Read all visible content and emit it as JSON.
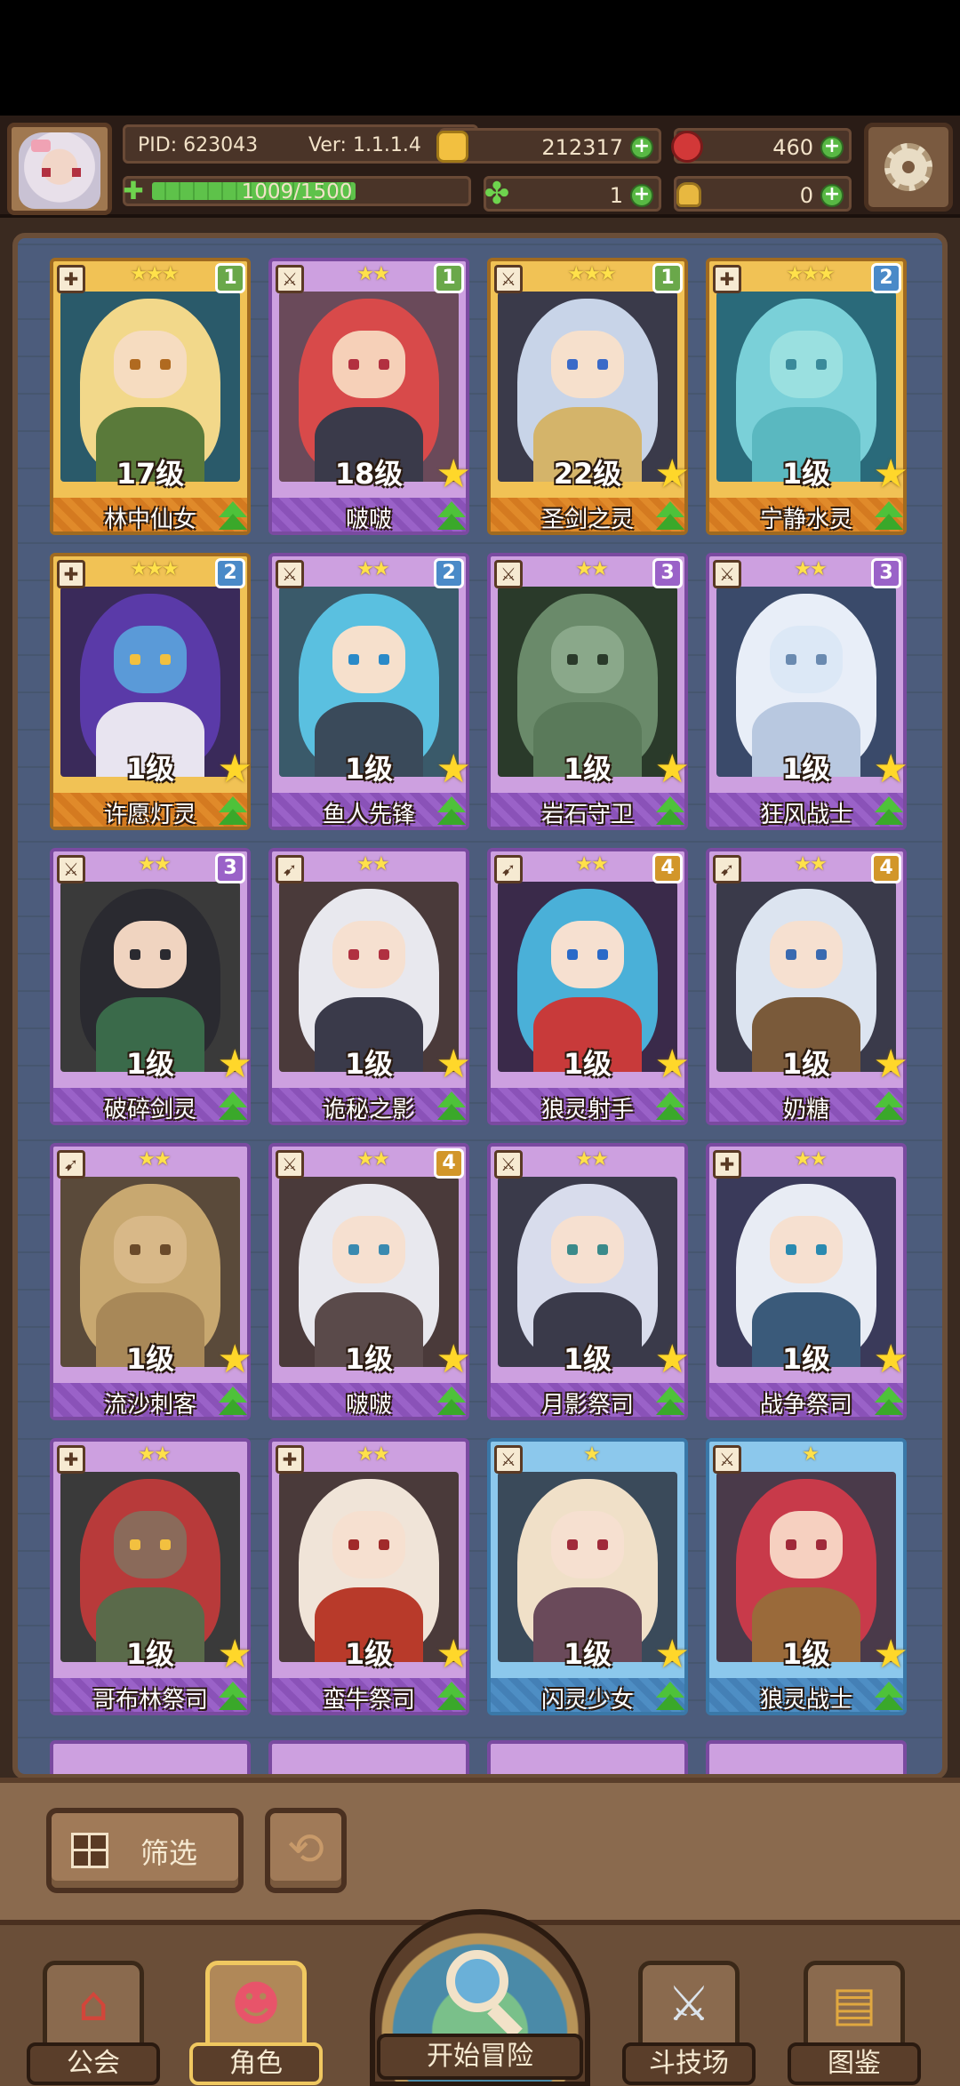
{
  "header": {
    "pid": "PID: 623043",
    "version": "Ver: 1.1.1.4",
    "xp_text": "1009/1500",
    "xp_fraction": 0.673,
    "gold": "212317",
    "apples": "460",
    "clovers": "1",
    "keys": "0"
  },
  "cards": [
    {
      "name": "林中仙女",
      "level": "17级",
      "stars": "★★★",
      "rank": "1",
      "rank_class": "r1",
      "frame": "gold",
      "class_icon": "✚",
      "hair": "#f2d88a",
      "skin": "#f6dcc0",
      "body": "#5a7a3a",
      "eye": "#b06a20",
      "bg": "#2a5a6a",
      "up": false
    },
    {
      "name": "啵啵",
      "level": "18级",
      "stars": "★★",
      "rank": "1",
      "rank_class": "r1",
      "frame": "purple",
      "class_icon": "⚔",
      "hair": "#d84a4a",
      "skin": "#f6d0b8",
      "body": "#3a3a4a",
      "eye": "#b23040",
      "bg": "#6a4a5a",
      "up": true
    },
    {
      "name": "圣剑之灵",
      "level": "22级",
      "stars": "★★★",
      "rank": "1",
      "rank_class": "r1",
      "frame": "gold",
      "class_icon": "⚔",
      "hair": "#c8d4e8",
      "skin": "#f6e0cc",
      "body": "#d4b46a",
      "eye": "#3a6ac8",
      "bg": "#3a3a4a",
      "up": true
    },
    {
      "name": "宁静水灵",
      "level": "1级",
      "stars": "★★★",
      "rank": "2",
      "rank_class": "r2",
      "frame": "gold",
      "class_icon": "✚",
      "hair": "#7ad0d8",
      "skin": "#9ae0e0",
      "body": "#5ab8c0",
      "eye": "#3a8a9a",
      "bg": "#2a6a7a",
      "up": true
    },
    {
      "name": "许愿灯灵",
      "level": "1级",
      "stars": "★★★",
      "rank": "2",
      "rank_class": "r2",
      "frame": "gold",
      "class_icon": "✚",
      "hair": "#5a3aa8",
      "skin": "#5a9ad8",
      "body": "#e8e4f0",
      "eye": "#f2c040",
      "bg": "#3a2a5a",
      "up": true
    },
    {
      "name": "鱼人先锋",
      "level": "1级",
      "stars": "★★",
      "rank": "2",
      "rank_class": "r2",
      "frame": "purple",
      "class_icon": "⚔",
      "hair": "#5ac0e0",
      "skin": "#f6e0cc",
      "body": "#3a4a5a",
      "eye": "#2a8ac8",
      "bg": "#3a5a6a",
      "up": true
    },
    {
      "name": "岩石守卫",
      "level": "1级",
      "stars": "★★",
      "rank": "3",
      "rank_class": "r3",
      "frame": "purple",
      "class_icon": "⚔",
      "hair": "#6a8a6a",
      "skin": "#8aa88a",
      "body": "#5a7a5a",
      "eye": "#2a3a2a",
      "bg": "#2a3a2a",
      "up": true
    },
    {
      "name": "狂风战士",
      "level": "1级",
      "stars": "★★",
      "rank": "3",
      "rank_class": "r3",
      "frame": "purple",
      "class_icon": "⚔",
      "hair": "#e8eef8",
      "skin": "#dce8f6",
      "body": "#b8c8e0",
      "eye": "#6a8ab0",
      "bg": "#3a4a6a",
      "up": true
    },
    {
      "name": "破碎剑灵",
      "level": "1级",
      "stars": "★★",
      "rank": "3",
      "rank_class": "r3",
      "frame": "purple",
      "class_icon": "⚔",
      "hair": "#2a2a30",
      "skin": "#f0d4c0",
      "body": "#3a6a4a",
      "eye": "#2a2a30",
      "bg": "#3a3a3a",
      "up": true
    },
    {
      "name": "诡秘之影",
      "level": "1级",
      "stars": "★★",
      "rank": "",
      "rank_class": "",
      "frame": "purple",
      "class_icon": "➹",
      "hair": "#e8e8ee",
      "skin": "#f6e0d0",
      "body": "#3a3a4a",
      "eye": "#b03040",
      "bg": "#4a3a3a",
      "up": true
    },
    {
      "name": "狼灵射手",
      "level": "1级",
      "stars": "★★",
      "rank": "4",
      "rank_class": "r4",
      "frame": "purple",
      "class_icon": "➹",
      "hair": "#4ab0d8",
      "skin": "#f6e0d0",
      "body": "#c83a3a",
      "eye": "#2a6ac8",
      "bg": "#3a2a4a",
      "up": true
    },
    {
      "name": "奶糖",
      "level": "1级",
      "stars": "★★",
      "rank": "4",
      "rank_class": "r4",
      "frame": "purple",
      "class_icon": "➹",
      "hair": "#dce4f0",
      "skin": "#f6e0d0",
      "body": "#7a5a3a",
      "eye": "#3a6ab0",
      "bg": "#3a3a4a",
      "up": true
    },
    {
      "name": "流沙刺客",
      "level": "1级",
      "stars": "★★",
      "rank": "",
      "rank_class": "",
      "frame": "purple",
      "class_icon": "➹",
      "hair": "#c8a870",
      "skin": "#d8b888",
      "body": "#a88858",
      "eye": "#6a4a2a",
      "bg": "#5a4a3a",
      "up": true
    },
    {
      "name": "啵啵",
      "level": "1级",
      "stars": "★★",
      "rank": "4",
      "rank_class": "r4",
      "frame": "purple",
      "class_icon": "⚔",
      "hair": "#e8e8ee",
      "skin": "#f6e0d0",
      "body": "#5a4a4a",
      "eye": "#3a8ab0",
      "bg": "#4a3a3a",
      "up": true
    },
    {
      "name": "月影祭司",
      "level": "1级",
      "stars": "★★",
      "rank": "",
      "rank_class": "",
      "frame": "purple",
      "class_icon": "⚔",
      "hair": "#d8dcec",
      "skin": "#f6e0d0",
      "body": "#3a3a4a",
      "eye": "#3a8a8a",
      "bg": "#3a3a4a",
      "up": true
    },
    {
      "name": "战争祭司",
      "level": "1级",
      "stars": "★★",
      "rank": "",
      "rank_class": "",
      "frame": "purple",
      "class_icon": "✚",
      "hair": "#e8ecf4",
      "skin": "#f6e0d0",
      "body": "#3a5a7a",
      "eye": "#2a8ab0",
      "bg": "#3a3a5a",
      "up": true
    },
    {
      "name": "哥布林祭司",
      "level": "1级",
      "stars": "★★",
      "rank": "",
      "rank_class": "",
      "frame": "purple",
      "class_icon": "✚",
      "hair": "#b83a3a",
      "skin": "#8a6a5a",
      "body": "#5a6a4a",
      "eye": "#f2c040",
      "bg": "#3a3a3a",
      "up": true
    },
    {
      "name": "蛮牛祭司",
      "level": "1级",
      "stars": "★★",
      "rank": "",
      "rank_class": "",
      "frame": "purple",
      "class_icon": "✚",
      "hair": "#f0e4d8",
      "skin": "#f6e0d0",
      "body": "#b83a2a",
      "eye": "#a02a2a",
      "bg": "#4a3a3a",
      "up": true
    },
    {
      "name": "闪灵少女",
      "level": "1级",
      "stars": "★",
      "rank": "",
      "rank_class": "",
      "frame": "blue",
      "class_icon": "⚔",
      "hair": "#f0e0c8",
      "skin": "#f6e0d0",
      "body": "#6a4a5a",
      "eye": "#a02a3a",
      "bg": "#3a4a5a",
      "up": true
    },
    {
      "name": "狼灵战士",
      "level": "1级",
      "stars": "★",
      "rank": "",
      "rank_class": "",
      "frame": "blue",
      "class_icon": "⚔",
      "hair": "#c83a4a",
      "skin": "#f6d0c0",
      "body": "#9a6a3a",
      "eye": "#a02a3a",
      "bg": "#4a3a4a",
      "up": true
    }
  ],
  "filter": {
    "label": "筛选"
  },
  "nav": {
    "guild": "公会",
    "characters": "角色",
    "start": "开始冒险",
    "arena": "斗技场",
    "codex": "图鉴"
  }
}
